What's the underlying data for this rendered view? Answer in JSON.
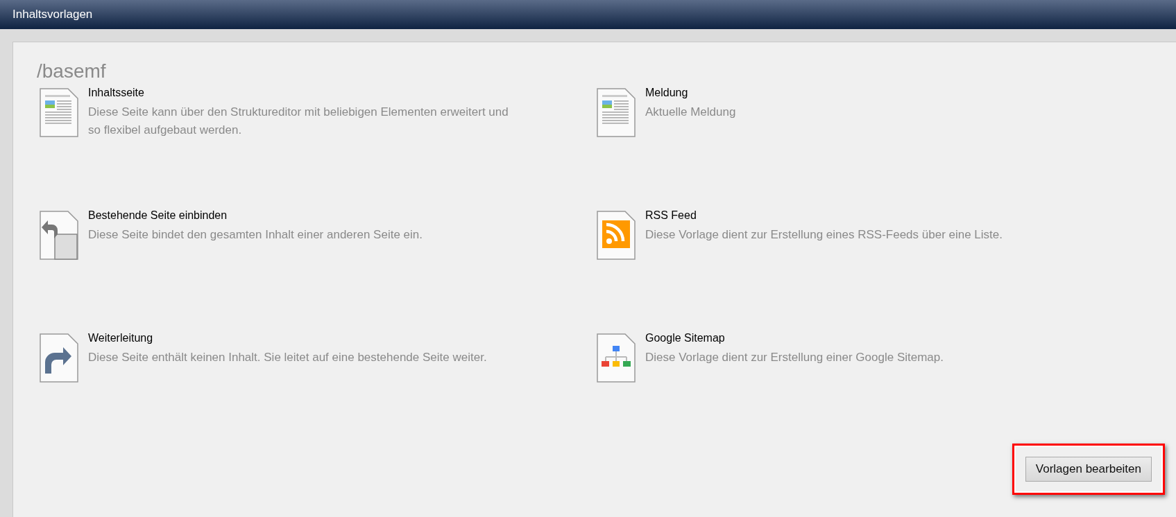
{
  "window": {
    "title": "Inhaltsvorlagen"
  },
  "path": "/basemf",
  "templates": [
    {
      "kind": "document",
      "title": "Inhaltsseite",
      "description": "Diese Seite kann über den Struktureditor mit beliebigen Elementen erweitert und so flexibel aufgebaut werden."
    },
    {
      "kind": "document",
      "title": "Meldung",
      "description": "Aktuelle Meldung"
    },
    {
      "kind": "include",
      "title": "Bestehende Seite einbinden",
      "description": "Diese Seite bindet den gesamten Inhalt einer anderen Seite ein."
    },
    {
      "kind": "rss",
      "title": "RSS Feed",
      "description": "Diese Vorlage dient zur Erstellung eines RSS-Feeds über eine Liste."
    },
    {
      "kind": "redirect",
      "title": "Weiterleitung",
      "description": "Diese Seite enthält keinen Inhalt. Sie leitet auf eine bestehende Seite weiter."
    },
    {
      "kind": "sitemap",
      "title": "Google Sitemap",
      "description": "Diese Vorlage dient zur Erstellung einer Google Sitemap."
    }
  ],
  "edit_button": {
    "label": "Vorlagen bearbeiten",
    "highlighted": true
  }
}
